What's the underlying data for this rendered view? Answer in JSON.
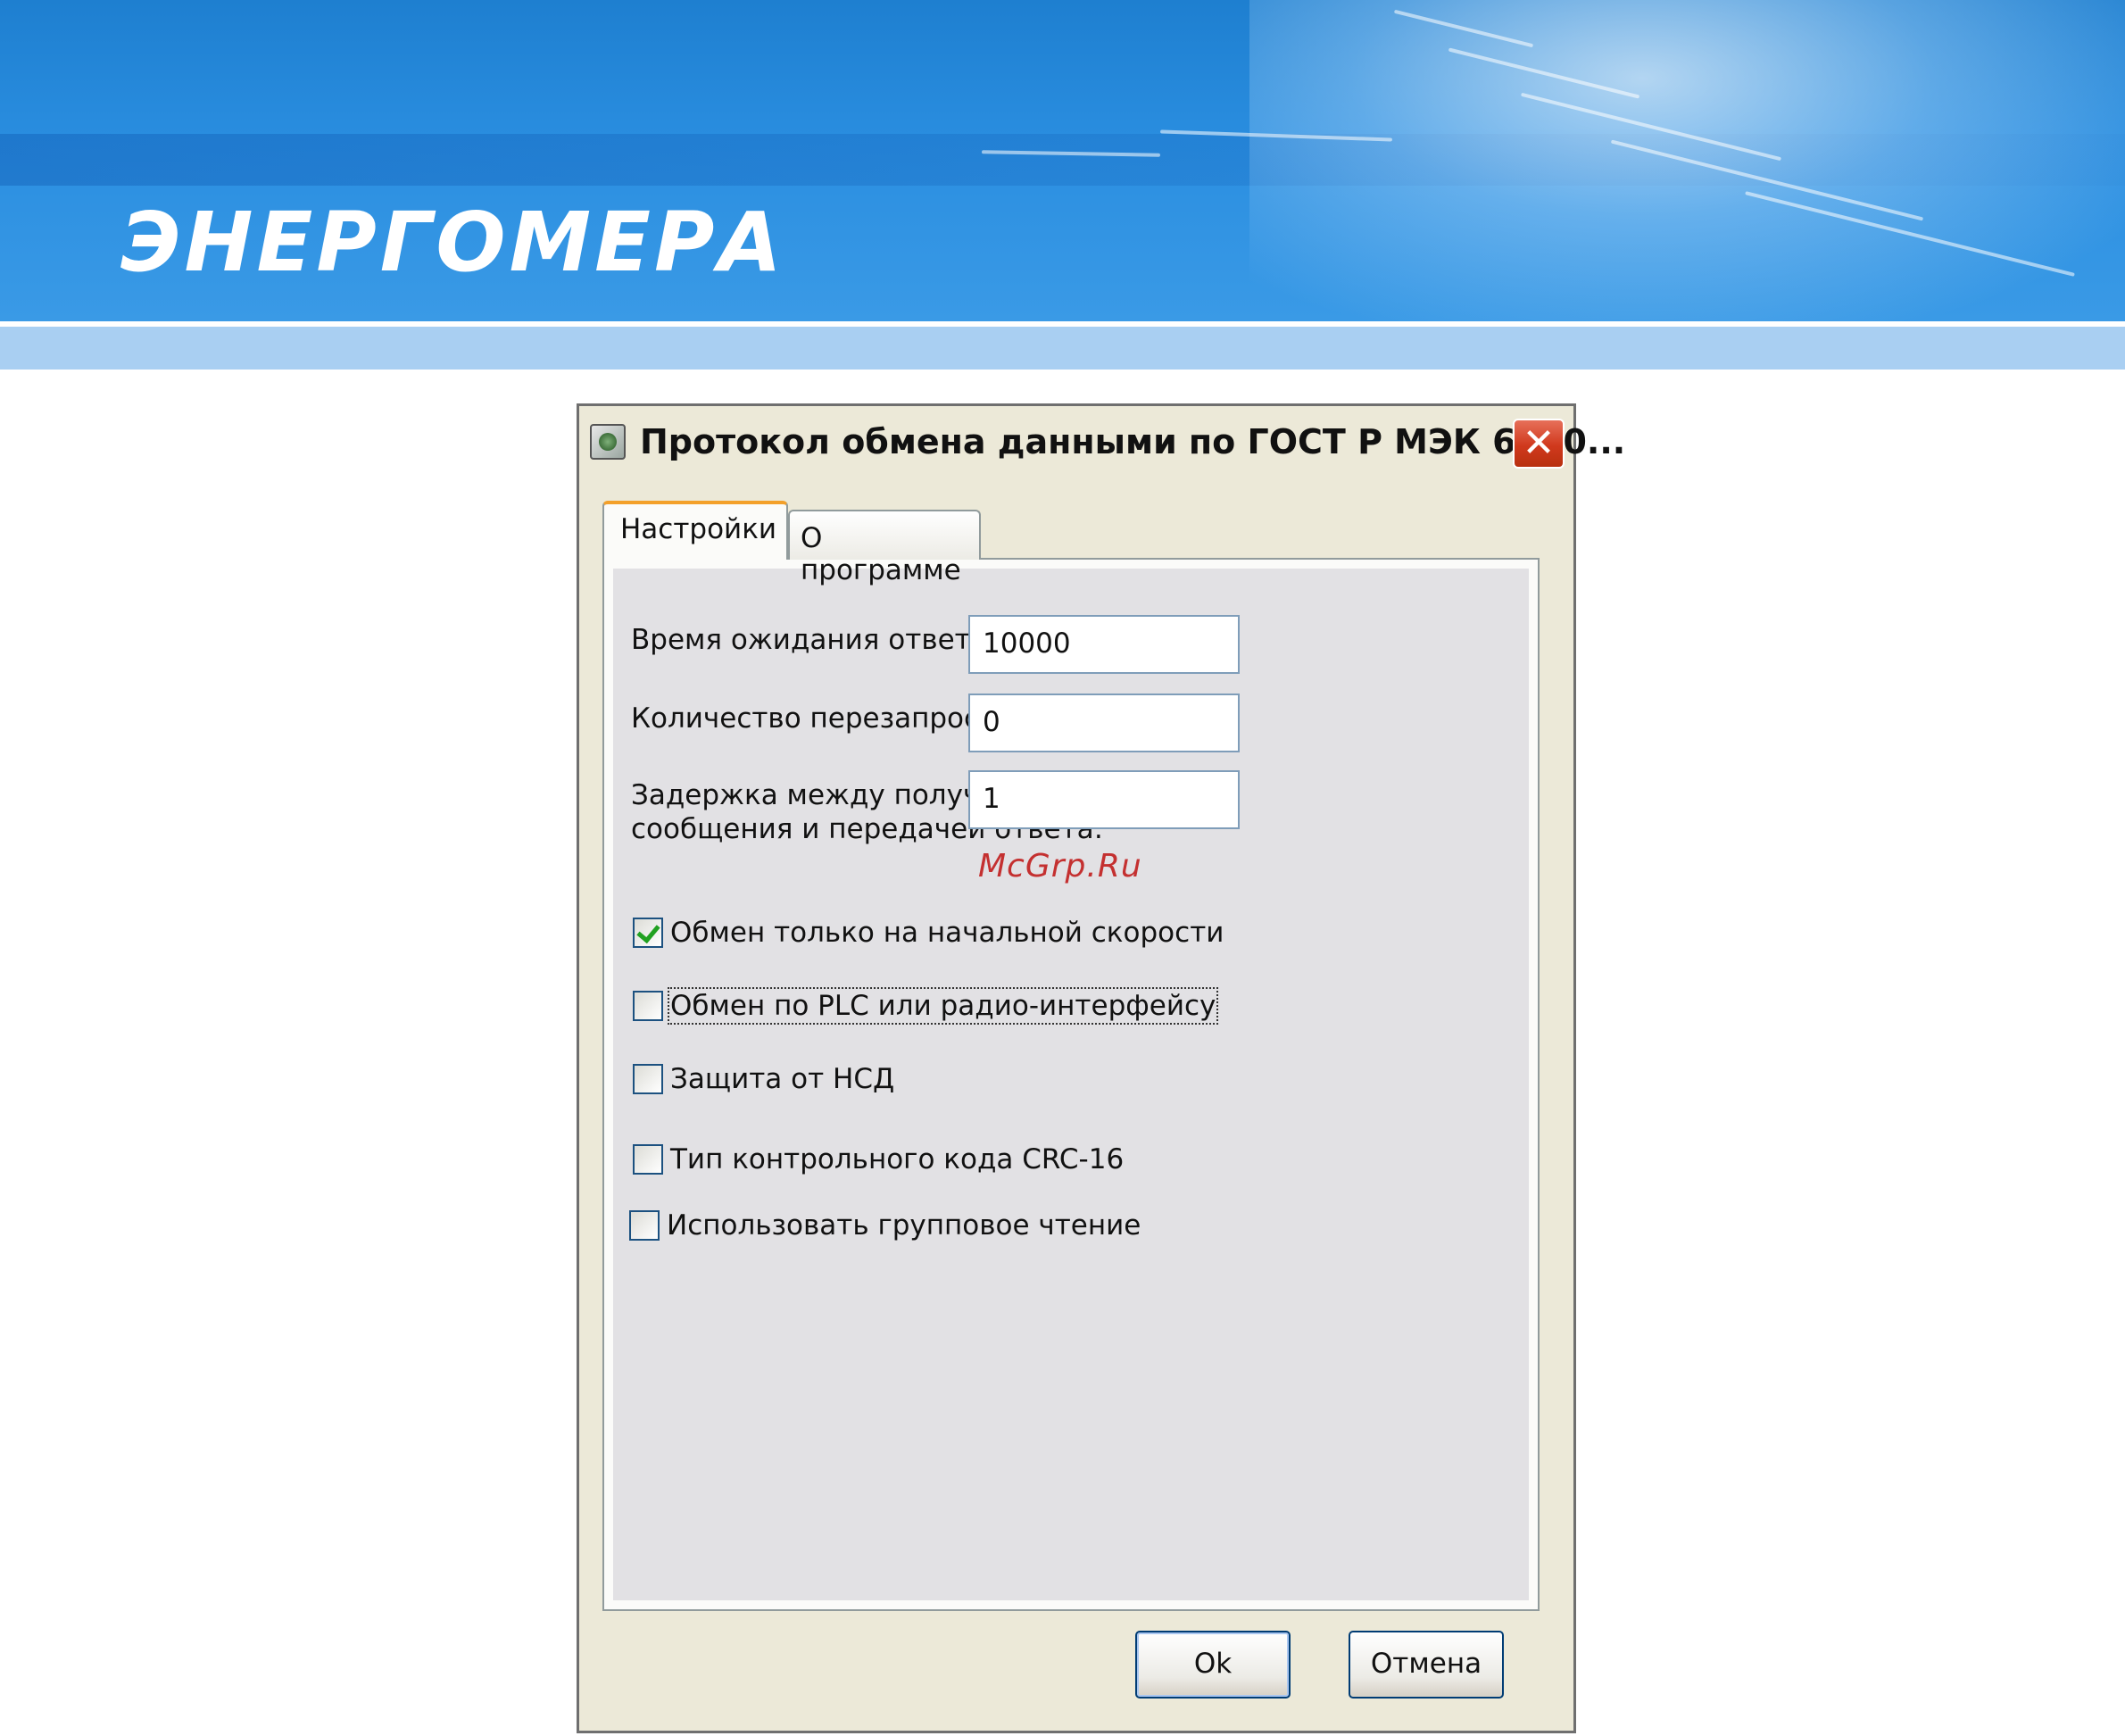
{
  "banner": {
    "logo_text": "ЭНЕРГОМЕРА",
    "colors": {
      "primary": "#2a8ee0",
      "light_band": "#a9cff2"
    }
  },
  "window": {
    "title": "Протокол обмена данными по ГОСТ Р МЭК 6110...",
    "close_label": "✕",
    "tabs": [
      {
        "label": "Настройки",
        "active": true
      },
      {
        "label": "О программе",
        "active": false
      }
    ],
    "fields": [
      {
        "label": "Время ожидания ответа:",
        "value": "10000"
      },
      {
        "label": "Количество перезапросов:",
        "value": "0"
      },
      {
        "label_line1": "Задержка между получением",
        "label_line2": "сообщения и передачей ответа:",
        "value": "1"
      }
    ],
    "checkboxes": [
      {
        "label": "Обмен только на начальной скорости",
        "checked": true
      },
      {
        "label": "Обмен по PLC или радио-интерфейсу",
        "checked": false,
        "focused": true
      },
      {
        "label": "Защита от НСД",
        "checked": false
      },
      {
        "label": "Тип контрольного кода CRC-16",
        "checked": false
      },
      {
        "label": "Использовать групповое чтение",
        "checked": false
      }
    ],
    "buttons": {
      "ok": "Ok",
      "cancel": "Отмена"
    }
  },
  "watermark": "McGrp.Ru"
}
